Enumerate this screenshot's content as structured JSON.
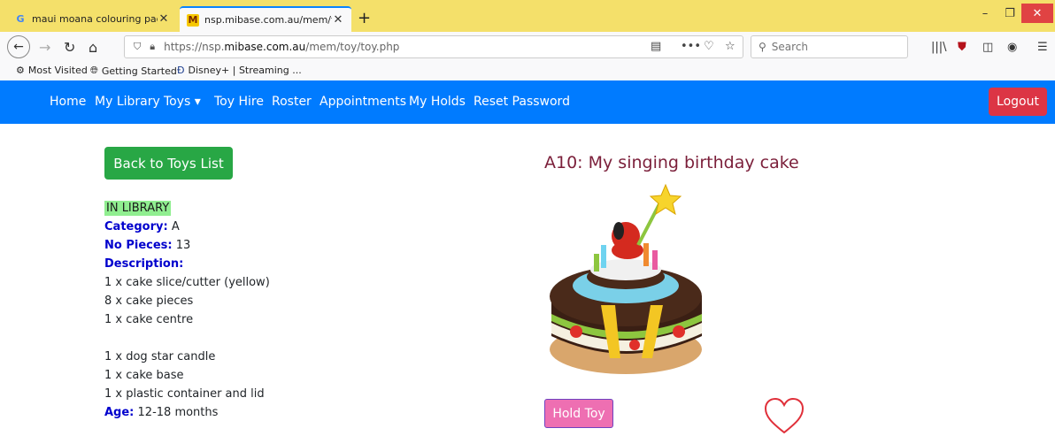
{
  "browser": {
    "tabs": [
      {
        "title": "maui moana colouring pages -",
        "favicon": "google-g-icon",
        "active": false
      },
      {
        "title": "nsp.mibase.com.au/mem/toy/",
        "favicon": "mibase-m-icon",
        "active": true
      }
    ],
    "url_prefix": "https://nsp.",
    "url_domain": "mibase.com.au",
    "url_path": "/mem/toy/toy.php",
    "search_placeholder": "Search",
    "bookmarks": [
      "Most Visited",
      "Getting Started",
      "Disney+ | Streaming ..."
    ]
  },
  "nav": {
    "links": [
      "Home",
      "My Library",
      "Toys ▾",
      "Toy Hire",
      "Roster",
      "Appointments",
      "My Holds",
      "Reset Password"
    ],
    "logout_label": "Logout"
  },
  "toy": {
    "back_label": "Back to Toys List",
    "status": "IN LIBRARY",
    "category_label": "Category:",
    "category": "A",
    "pieces_label": "No Pieces:",
    "pieces": "13",
    "description_label": "Description:",
    "description_lines": [
      "1 x cake slice/cutter (yellow)",
      "8 x cake pieces",
      "1 x cake centre",
      "",
      "1 x dog star candle",
      "1 x cake base",
      "1 x plastic container and lid"
    ],
    "age_label": "Age:",
    "age": "12-18 months",
    "title": "A10: My singing birthday cake",
    "hold_label": "Hold Toy"
  },
  "colors": {
    "nav_blue": "#007bff",
    "logout_red": "#dc3545",
    "back_green": "#28a745",
    "status_bg": "#90ee90",
    "label_blue": "#0000cd",
    "title_maroon": "#7b1f3a",
    "hold_pink": "#ee6fb2",
    "heart_red": "#e0303a"
  }
}
